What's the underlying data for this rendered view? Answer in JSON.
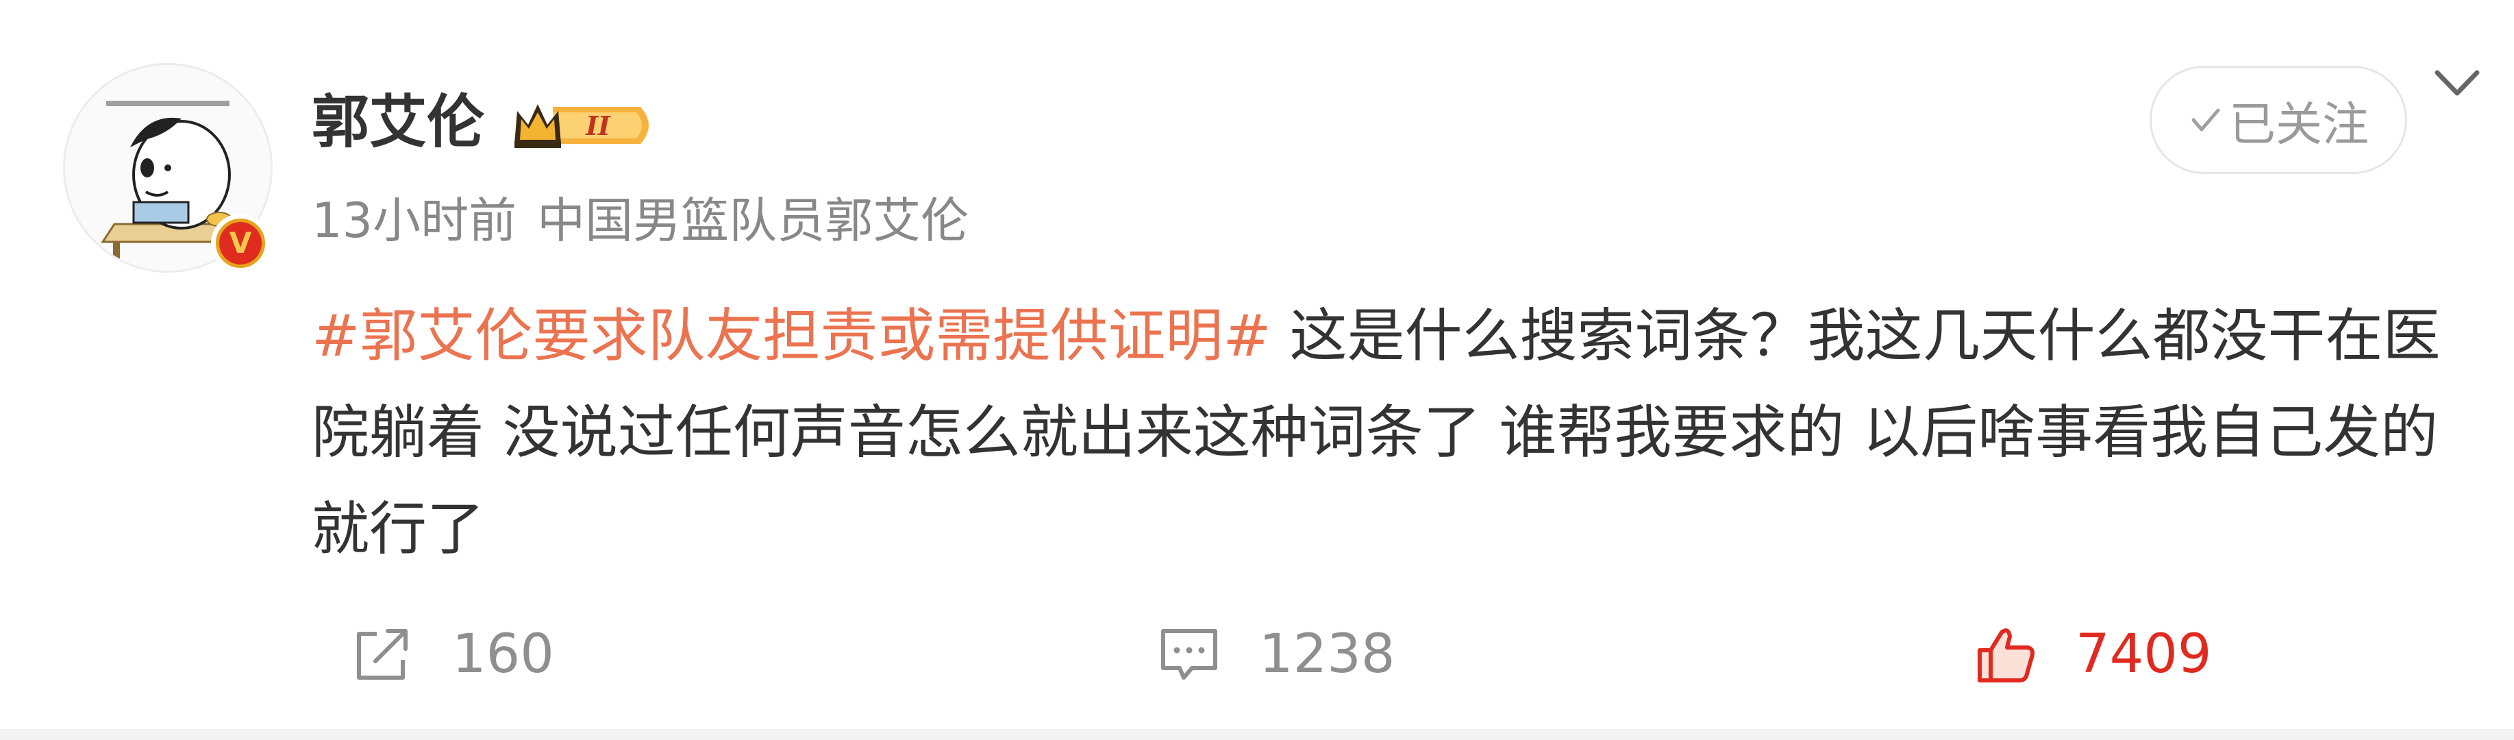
{
  "post": {
    "author": {
      "name": "郭艾伦",
      "verified_badge_letter": "V",
      "vip_level": "II"
    },
    "follow_button_label": "已关注",
    "meta": {
      "time": "13小时前",
      "description": "中国男篮队员郭艾伦"
    },
    "content": {
      "hashtag": "#郭艾伦要求队友担责或需提供证明#",
      "text": " 这是什么搜索词条？我这几天什么都没干在医院躺着 没说过任何声音怎么就出来这种词条了  谁帮我要求的 以后啥事看我自己发的就行了"
    },
    "actions": {
      "repost_count": "160",
      "comment_count": "1238",
      "like_count": "7409"
    },
    "colors": {
      "hashtag": "#eb7350",
      "like": "#e0291f",
      "verified_badge": "#e02b1f",
      "text": "#333333",
      "muted": "#888888"
    }
  }
}
